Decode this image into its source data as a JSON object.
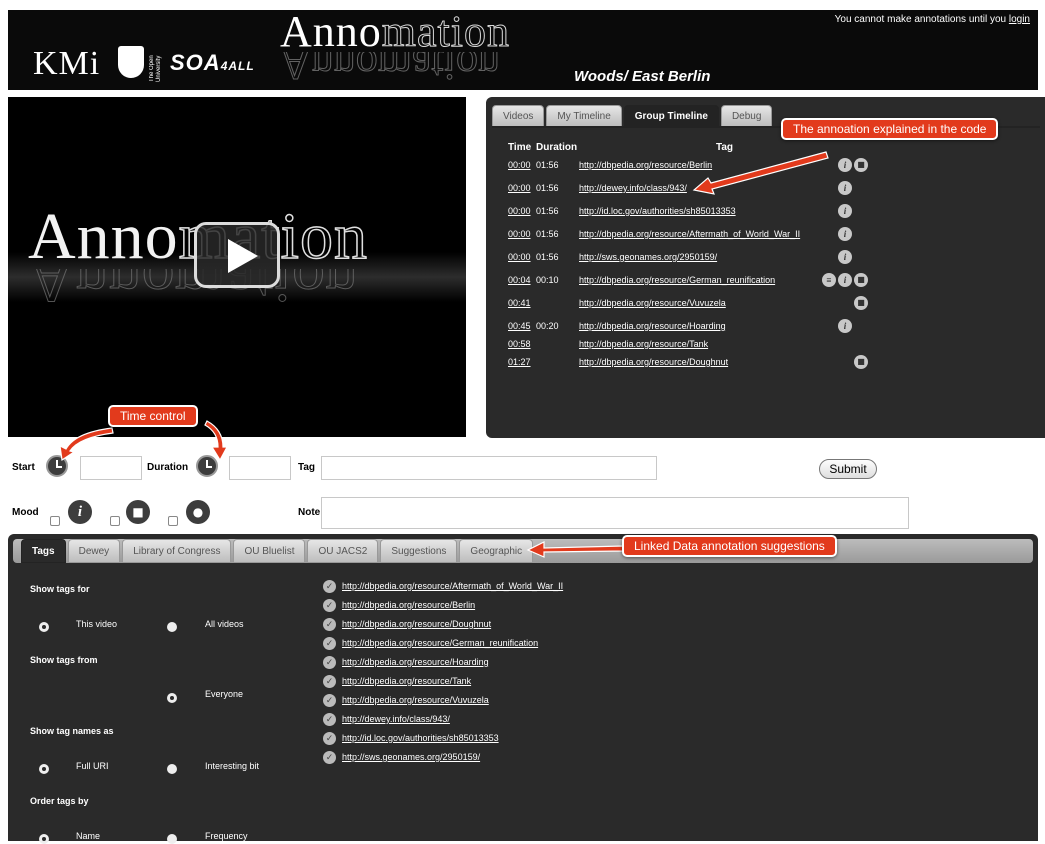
{
  "header": {
    "kmi_logo": "KMi",
    "ou_logo_text": "The Open University",
    "soa_logo": "SOA",
    "soa_logo_suffix": "4ALL",
    "app_title_a": "Anno",
    "app_title_b": "mation",
    "video_title": "Woods/ East Berlin",
    "login_message": "You cannot make annotations until you",
    "login_link": "login"
  },
  "video": {
    "logo_a": "Anno",
    "logo_b": "mation",
    "play_icon": "play-icon"
  },
  "timeline": {
    "tabs": [
      "Videos",
      "My Timeline",
      "Group Timeline",
      "Debug"
    ],
    "active_tab": "Group Timeline",
    "headers": {
      "time": "Time",
      "duration": "Duration",
      "tag": "Tag"
    },
    "rows": [
      {
        "time": "00:00",
        "duration": "01:56",
        "tag": "http://dbpedia.org/resource/Berlin",
        "icons": [
          "info",
          "camera"
        ]
      },
      {
        "time": "00:00",
        "duration": "01:56",
        "tag": "http://dewey.info/class/943/",
        "icons": [
          "info"
        ]
      },
      {
        "time": "00:00",
        "duration": "01:56",
        "tag": "http://id.loc.gov/authorities/sh85013353",
        "icons": [
          "info"
        ]
      },
      {
        "time": "00:00",
        "duration": "01:56",
        "tag": "http://dbpedia.org/resource/Aftermath_of_World_War_II",
        "icons": [
          "info"
        ]
      },
      {
        "time": "00:00",
        "duration": "01:56",
        "tag": "http://sws.geonames.org/2950159/",
        "icons": [
          "info"
        ]
      },
      {
        "time": "00:04",
        "duration": "00:10",
        "tag": "http://dbpedia.org/resource/German_reunification",
        "icons": [
          "note",
          "info",
          "camera"
        ]
      },
      {
        "time": "00:41",
        "duration": "",
        "tag": "http://dbpedia.org/resource/Vuvuzela",
        "icons": [
          "camera"
        ]
      },
      {
        "time": "00:45",
        "duration": "00:20",
        "tag": "http://dbpedia.org/resource/Hoarding",
        "icons": [
          "info"
        ]
      },
      {
        "time": "00:58",
        "duration": "",
        "tag": "http://dbpedia.org/resource/Tank",
        "icons": []
      },
      {
        "time": "01:27",
        "duration": "",
        "tag": "http://dbpedia.org/resource/Doughnut",
        "icons": [
          "camera"
        ]
      }
    ]
  },
  "callouts": {
    "code": "The annoation explained in the code",
    "time": "Time control",
    "linked": "Linked Data annotation suggestions"
  },
  "form": {
    "start_label": "Start",
    "duration_label": "Duration",
    "tag_label": "Tag",
    "submit_label": "Submit",
    "mood_label": "Mood",
    "note_label": "Note",
    "start_value": "",
    "duration_value": "",
    "tag_value": "",
    "note_value": ""
  },
  "bottom": {
    "tabs": [
      "Tags",
      "Dewey",
      "Library of Congress",
      "OU Bluelist",
      "OU JACS2",
      "Suggestions",
      "Geographic"
    ],
    "active_tab": "Tags",
    "show_tags_for": "Show tags for",
    "this_video": "This video",
    "all_videos": "All videos",
    "show_tags_from": "Show tags from",
    "everyone": "Everyone",
    "show_tag_names_as": "Show tag names as",
    "full_uri": "Full URI",
    "interesting_bit": "Interesting bit",
    "order_tags_by": "Order tags by",
    "name": "Name",
    "frequency": "Frequency",
    "tags": [
      "http://dbpedia.org/resource/Aftermath_of_World_War_II",
      "http://dbpedia.org/resource/Berlin",
      "http://dbpedia.org/resource/Doughnut",
      "http://dbpedia.org/resource/German_reunification",
      "http://dbpedia.org/resource/Hoarding",
      "http://dbpedia.org/resource/Tank",
      "http://dbpedia.org/resource/Vuvuzela",
      "http://dewey.info/class/943/",
      "http://id.loc.gov/authorities/sh85013353",
      "http://sws.geonames.org/2950159/"
    ]
  },
  "colors": {
    "callout": "#e23a1c",
    "panel": "#2a2a2a",
    "header": "#0a0a0a"
  }
}
